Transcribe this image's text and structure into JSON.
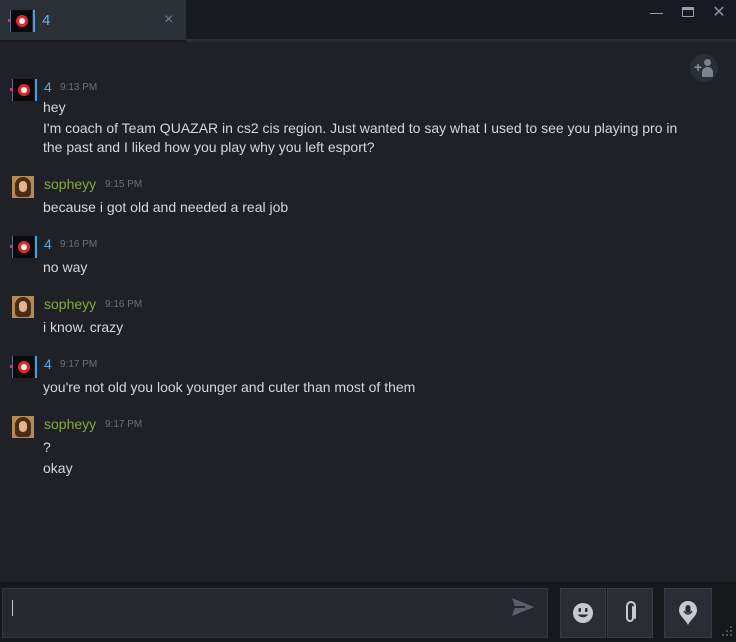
{
  "tab": {
    "title": "4",
    "close_glyph": "×"
  },
  "window_controls": {
    "close_glyph": "✕"
  },
  "colors": {
    "name_coach": "#5aa6e0",
    "name_sophie": "#86a83d",
    "message_text": "#d4d6d9",
    "timestamp": "#6b7079",
    "background": "#1f2126"
  },
  "icons": {
    "invite": "add-friend-icon",
    "send": "send-arrow-icon",
    "emoji": "emoji-icon",
    "attach": "paperclip-icon",
    "voice": "microphone-icon"
  },
  "messages": [
    {
      "sender": "4",
      "time": "9:13 PM",
      "lines": [
        "hey",
        "I'm coach of Team QUAZAR in cs2 cis region. Just wanted to say what I used to see you playing pro in",
        "the past and I liked how you play why you left esport?"
      ]
    },
    {
      "sender": "sopheyy",
      "time": "9:15 PM",
      "lines": [
        "because i got old and needed a real job"
      ]
    },
    {
      "sender": "4",
      "time": "9:16 PM",
      "lines": [
        "no way"
      ]
    },
    {
      "sender": "sopheyy",
      "time": "9:16 PM",
      "lines": [
        "i know. crazy"
      ]
    },
    {
      "sender": "4",
      "time": "9:17 PM",
      "lines": [
        "you're not old you look younger and cuter than most of them"
      ]
    },
    {
      "sender": "sopheyy",
      "time": "9:17 PM",
      "lines": [
        "?",
        "okay"
      ]
    }
  ],
  "input": {
    "value": ""
  }
}
